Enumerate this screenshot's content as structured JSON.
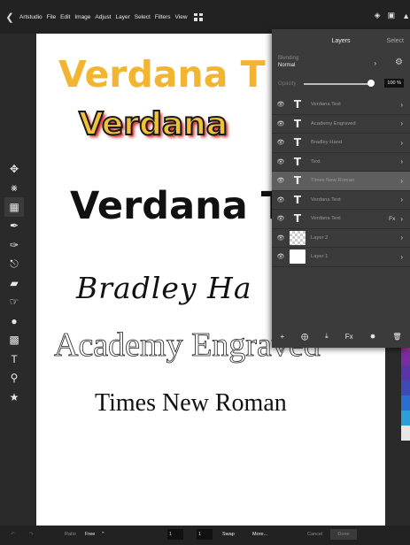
{
  "menubar": {
    "back_icon": "chevron-left-icon",
    "app_name": "Artstudio",
    "menus": [
      "File",
      "Edit",
      "Image",
      "Adjust",
      "Layer",
      "Select",
      "Filters",
      "View"
    ]
  },
  "canvas_texts": [
    "Verdana T",
    "Verdana",
    "Verdana T",
    "Bradley Ha",
    "Academy Engraved",
    "Times New Roman"
  ],
  "layers_panel": {
    "title": "Layers",
    "select_label": "Select",
    "blending_label": "Blending",
    "blending_value": "Normal",
    "opacity_label": "Opacity",
    "opacity_value": "100 %",
    "opacity_fraction": 1.0,
    "layers": [
      {
        "name": "Verdana Text",
        "thumb": "T",
        "fx": ""
      },
      {
        "name": "Academy Engraved",
        "thumb": "T",
        "fx": ""
      },
      {
        "name": "Bradley Hand",
        "thumb": "T",
        "fx": ""
      },
      {
        "name": "Text",
        "thumb": "T",
        "fx": ""
      },
      {
        "name": "Times New Roman",
        "thumb": "T",
        "fx": ""
      },
      {
        "name": "Verdana Text",
        "thumb": "T",
        "fx": ""
      },
      {
        "name": "Verdana Text",
        "thumb": "T",
        "fx": "Fx"
      },
      {
        "name": "Layer 2",
        "thumb": "",
        "fx": ""
      },
      {
        "name": "Layer 1",
        "thumb": "",
        "fx": ""
      }
    ],
    "footer_fx": "Fx"
  },
  "bottombar": {
    "ratio_label": "Ratio",
    "ratio_value": "Free",
    "width_value": "1",
    "height_value": "1",
    "swap_label": "Swap",
    "more_label": "More...",
    "cancel_label": "Cancel",
    "done_label": "Done"
  },
  "colors": {
    "swatches": [
      "#cfcfcf",
      "#bdbdbd",
      "#a4a4a4",
      "#c0282d",
      "#d03a3a",
      "#a12b8f",
      "#7a2ca0",
      "#5a35a8",
      "#3c4bb5",
      "#2a6ed0",
      "#2aa0d8",
      "#e7e7e7"
    ]
  }
}
